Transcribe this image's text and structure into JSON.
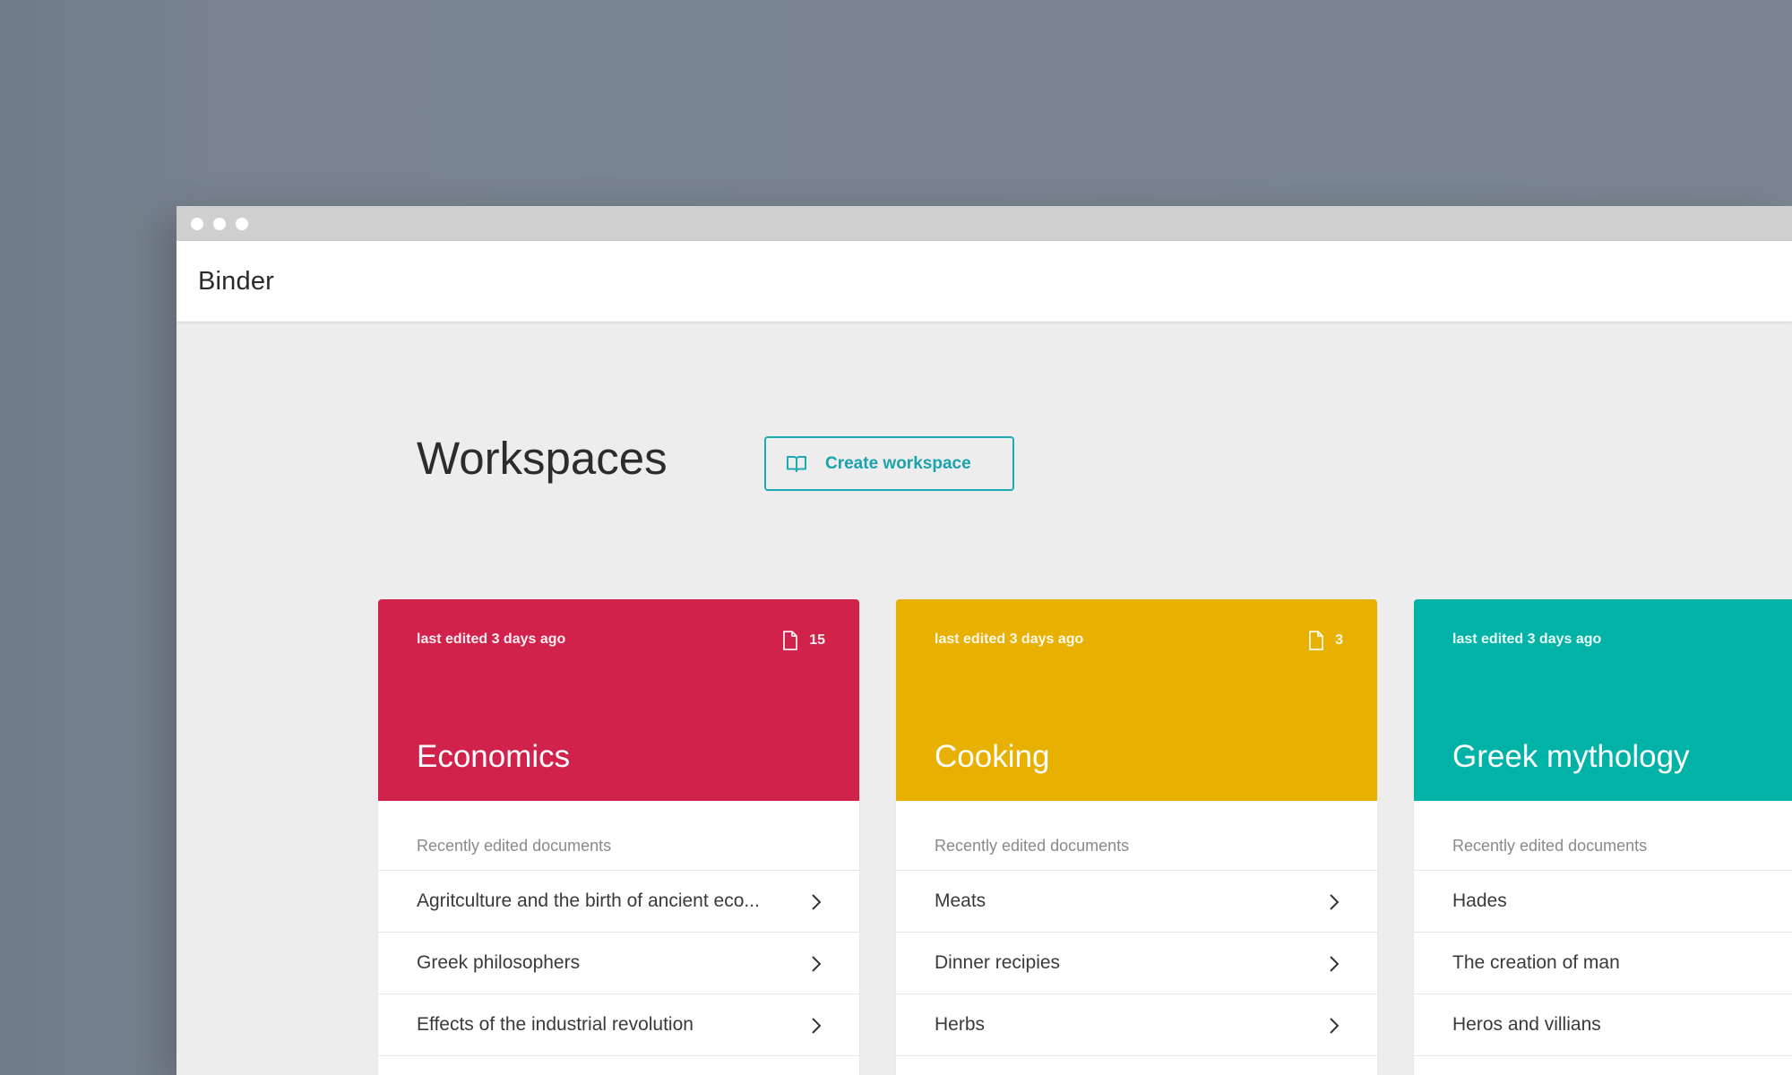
{
  "app": {
    "title": "Binder"
  },
  "page": {
    "title": "Workspaces",
    "create_button_label": "Create workspace"
  },
  "colors": {
    "economics": "#d0224b",
    "cooking": "#e8b000",
    "greek_mythology": "#00b3a6",
    "accent": "#1eaab3"
  },
  "section_label": "Recently edited documents",
  "workspaces": [
    {
      "name": "Economics",
      "last_edited": "last edited 3 days ago",
      "doc_count": "15",
      "documents": [
        "Agritculture and the birth of ancient eco...",
        "Greek philosophers",
        "Effects of the industrial revolution"
      ]
    },
    {
      "name": "Cooking",
      "last_edited": "last edited 3 days ago",
      "doc_count": "3",
      "documents": [
        "Meats",
        "Dinner recipies",
        "Herbs"
      ]
    },
    {
      "name": "Greek mythology",
      "last_edited": "last edited 3 days ago",
      "doc_count": "",
      "documents": [
        "Hades",
        "The creation of man",
        "Heros and villians"
      ]
    }
  ]
}
